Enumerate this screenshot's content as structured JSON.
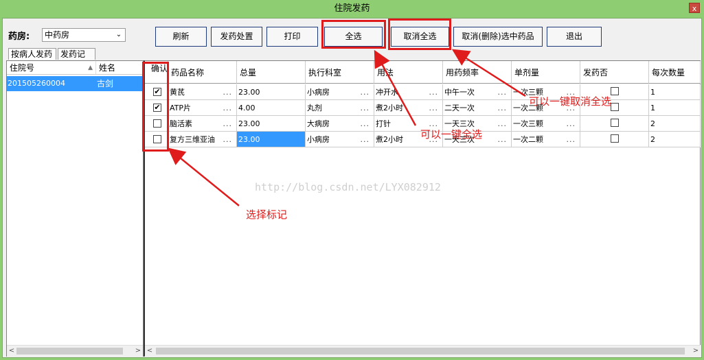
{
  "window": {
    "title": "住院发药",
    "close": "x"
  },
  "pharmacy": {
    "label": "药房:",
    "selected": "中药房"
  },
  "toolbar": [
    "刷新",
    "发药处置",
    "打印",
    "全选",
    "取消全选",
    "取消(删除)选中药品",
    "退出"
  ],
  "tabs": [
    "按病人发药",
    "发药记录"
  ],
  "patient_list": {
    "columns": [
      "住院号",
      "姓名"
    ],
    "rows": [
      {
        "id": "201505260004",
        "name": "古剑"
      }
    ]
  },
  "grid": {
    "columns": [
      "确认",
      "药品名称",
      "总量",
      "执行科室",
      "用法",
      "用药频率",
      "单剂量",
      "发药否",
      "每次数量"
    ],
    "rows": [
      {
        "confirm": true,
        "drug": "黄芪",
        "qty": "23.00",
        "dept": "小病房",
        "usage": "冲开水",
        "freq": "中午一次",
        "dose": "一次三颗",
        "dispensed": false,
        "per": "1"
      },
      {
        "confirm": true,
        "drug": "ATP片",
        "qty": "4.00",
        "dept": "丸剂",
        "usage": "煮2小时",
        "freq": "二天一次",
        "dose": "一次二颗",
        "dispensed": false,
        "per": "1"
      },
      {
        "confirm": false,
        "drug": "脑活素",
        "qty": "23.00",
        "dept": "大病房",
        "usage": "打针",
        "freq": "一天三次",
        "dose": "一次三颗",
        "dispensed": false,
        "per": "2"
      },
      {
        "confirm": false,
        "drug": "复方三维亚油",
        "qty": "23.00",
        "dept": "小病房",
        "usage": "煮2小时",
        "freq": "一天三次",
        "dose": "一次二颗",
        "dispensed": false,
        "per": "2"
      }
    ],
    "cell_dots": "..."
  },
  "annotations": {
    "cancel_all": "可以一键取消全选",
    "select_all": "可以一键全选",
    "select_mark": "选择标记",
    "color": "#e01b1b"
  },
  "watermark": "http://blog.csdn.net/LYX082912"
}
